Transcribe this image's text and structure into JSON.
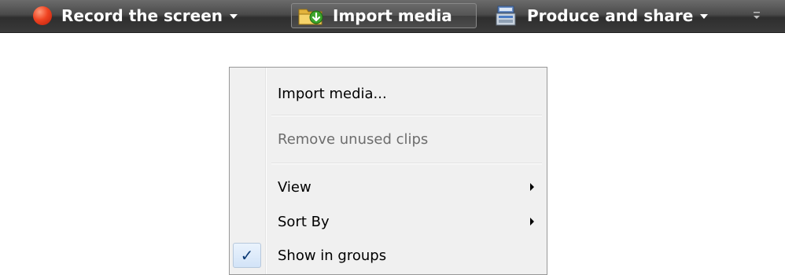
{
  "toolbar": {
    "record": {
      "label": "Record the screen",
      "icon": "record-icon",
      "has_dropdown": true
    },
    "import": {
      "label": "Import media",
      "icon": "import-folder-icon",
      "hovered": true
    },
    "produce": {
      "label": "Produce and share",
      "icon": "produce-share-icon",
      "has_dropdown": true
    },
    "overflow_icon": "toolbar-overflow-icon"
  },
  "context_menu": {
    "items": [
      {
        "label": "Import media...",
        "enabled": true
      },
      {
        "label": "Remove unused clips",
        "enabled": false
      },
      {
        "label": "View",
        "enabled": true,
        "submenu": true
      },
      {
        "label": "Sort By",
        "enabled": true,
        "submenu": true
      },
      {
        "label": "Show in groups",
        "enabled": true,
        "checked": true,
        "check_glyph": "✓"
      }
    ]
  },
  "colors": {
    "toolbar_bg": "#3a3a3a",
    "menu_bg": "#f0f0f0",
    "menu_border": "#979797",
    "disabled_text": "#6d6d6d",
    "check_highlight": "#d2e3f7"
  }
}
